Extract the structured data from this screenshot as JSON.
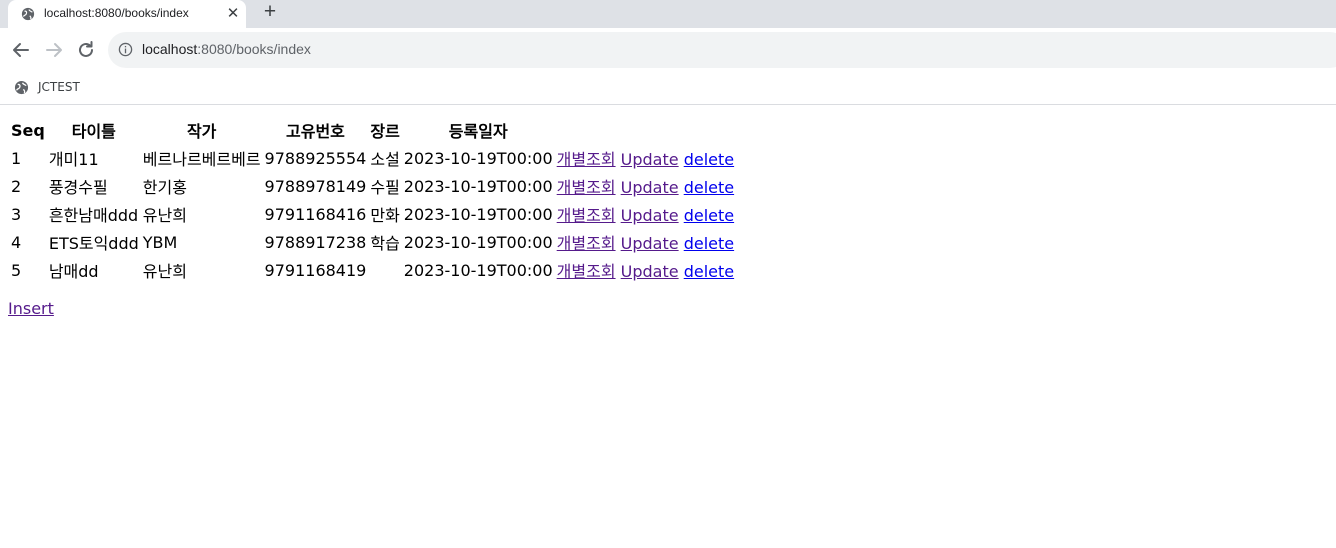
{
  "browser": {
    "tab_title": "localhost:8080/books/index",
    "close_glyph": "✕",
    "newtab_glyph": "+",
    "url_host": "localhost",
    "url_path": ":8080/books/index",
    "bookmark_label": "JCTEST",
    "icons": [
      "globe-icon",
      "close-icon",
      "plus-icon",
      "back-arrow-icon",
      "forward-arrow-icon",
      "reload-icon",
      "info-icon"
    ]
  },
  "table": {
    "headers": {
      "seq": "Seq",
      "title": "타이틀",
      "author": "작가",
      "isbn": "고유번호",
      "genre": "장르",
      "date": "등록일자"
    },
    "rows": [
      {
        "seq": "1",
        "title": "개미11",
        "author": "베르나르베르베르",
        "isbn": "9788925554",
        "genre": "소설",
        "date": "2023-10-19T00:00",
        "detail": "개별조회",
        "update": "Update",
        "delete": "delete"
      },
      {
        "seq": "2",
        "title": "풍경수필",
        "author": "한기홍",
        "isbn": "9788978149",
        "genre": "수필",
        "date": "2023-10-19T00:00",
        "detail": "개별조회",
        "update": "Update",
        "delete": "delete"
      },
      {
        "seq": "3",
        "title": "흔한남매ddd",
        "author": "유난희",
        "isbn": "9791168416",
        "genre": "만화",
        "date": "2023-10-19T00:00",
        "detail": "개별조회",
        "update": "Update",
        "delete": "delete"
      },
      {
        "seq": "4",
        "title": "ETS토익ddd",
        "author": "YBM",
        "isbn": "9788917238",
        "genre": "학습",
        "date": "2023-10-19T00:00",
        "detail": "개별조회",
        "update": "Update",
        "delete": "delete"
      },
      {
        "seq": "5",
        "title": "남매dd",
        "author": "유난희",
        "isbn": "9791168419",
        "genre": "",
        "date": "2023-10-19T00:00",
        "detail": "개별조회",
        "update": "Update",
        "delete": "delete"
      }
    ]
  },
  "insert_link": "Insert",
  "colors": {
    "link_visited": "#551a8b",
    "link_unvisited": "#0000ee",
    "tabstrip_bg": "#dee1e6",
    "omnibox_bg": "#f1f3f4"
  }
}
